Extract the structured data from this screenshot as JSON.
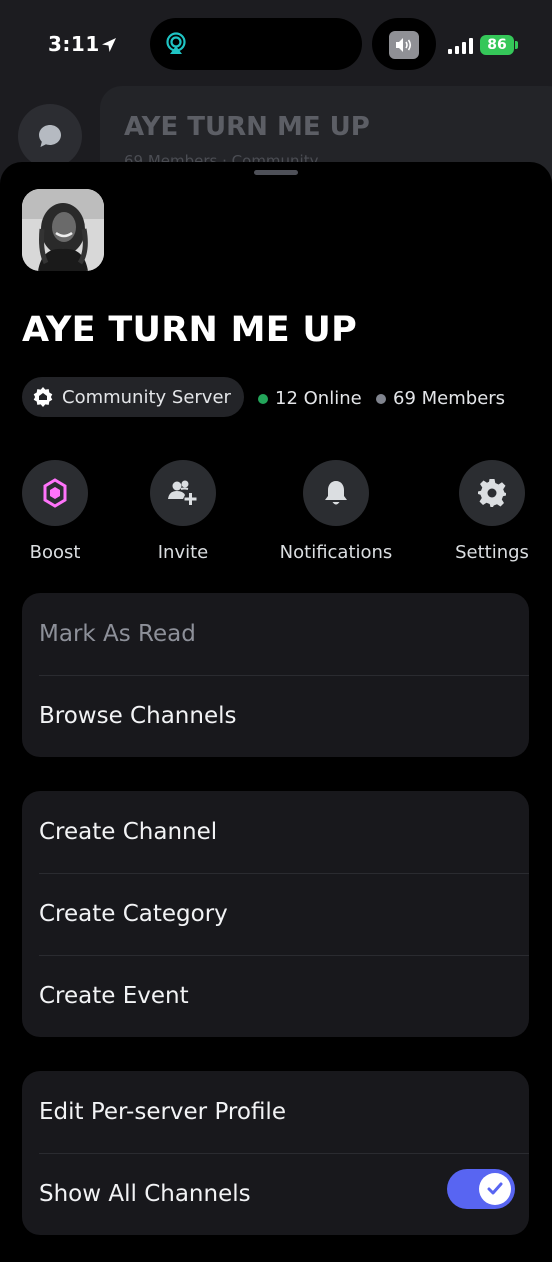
{
  "status_bar": {
    "time": "3:11",
    "battery": "86"
  },
  "background": {
    "server_title": "AYE TURN ME UP",
    "server_subtitle": "69 Members · Community"
  },
  "server": {
    "name": "AYE TURN ME UP",
    "community_label": "Community Server",
    "online": "12 Online",
    "members": "69 Members"
  },
  "actions": [
    {
      "label": "Boost",
      "icon": "boost-gem-icon"
    },
    {
      "label": "Invite",
      "icon": "add-member-icon"
    },
    {
      "label": "Notifications",
      "icon": "bell-icon"
    },
    {
      "label": "Settings",
      "icon": "gear-icon"
    }
  ],
  "menu_group_1": [
    "Mark As Read",
    "Browse Channels"
  ],
  "menu_group_2": [
    "Create Channel",
    "Create Category",
    "Create Event"
  ],
  "menu_group_3": [
    "Edit Per-server Profile",
    "Show All Channels"
  ],
  "colors": {
    "accent": "#5865f2",
    "online": "#23a55a",
    "offline": "#80848e",
    "boost": "#ff73fa"
  }
}
